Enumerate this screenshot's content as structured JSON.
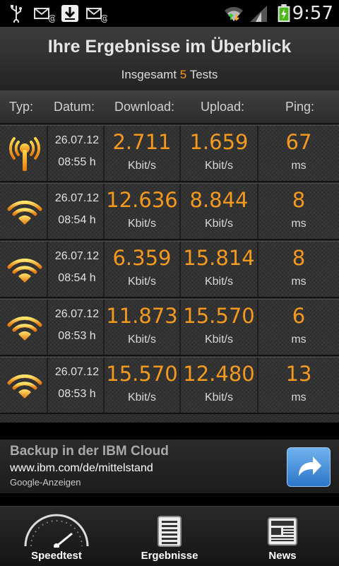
{
  "status_bar": {
    "time": "9:57",
    "icons": [
      "usb-icon",
      "voicemail-icon",
      "download-icon",
      "voicemail-icon",
      "wifi-icon",
      "signal-icon",
      "battery-charging-icon"
    ]
  },
  "header": {
    "title": "Ihre Ergebnisse im Überblick",
    "total_prefix": "Insgesamt",
    "total_count": "5",
    "total_suffix": "Tests"
  },
  "columns": {
    "type": "Typ:",
    "date": "Datum:",
    "download": "Download:",
    "upload": "Upload:",
    "ping": "Ping:"
  },
  "results": [
    {
      "type_icon": "cell-tower-icon",
      "date": "26.07.12",
      "time": "08:55 h",
      "download": "2.711",
      "download_unit": "Kbit/s",
      "upload": "1.659",
      "upload_unit": "Kbit/s",
      "ping": "67",
      "ping_unit": "ms"
    },
    {
      "type_icon": "wifi-icon",
      "date": "26.07.12",
      "time": "08:54 h",
      "download": "12.636",
      "download_unit": "Kbit/s",
      "upload": "8.844",
      "upload_unit": "Kbit/s",
      "ping": "8",
      "ping_unit": "ms"
    },
    {
      "type_icon": "wifi-icon",
      "date": "26.07.12",
      "time": "08:54 h",
      "download": "6.359",
      "download_unit": "Kbit/s",
      "upload": "15.814",
      "upload_unit": "Kbit/s",
      "ping": "8",
      "ping_unit": "ms"
    },
    {
      "type_icon": "wifi-icon",
      "date": "26.07.12",
      "time": "08:53 h",
      "download": "11.873",
      "download_unit": "Kbit/s",
      "upload": "15.570",
      "upload_unit": "Kbit/s",
      "ping": "6",
      "ping_unit": "ms"
    },
    {
      "type_icon": "wifi-icon",
      "date": "26.07.12",
      "time": "08:53 h",
      "download": "15.570",
      "download_unit": "Kbit/s",
      "upload": "12.480",
      "upload_unit": "Kbit/s",
      "ping": "13",
      "ping_unit": "ms"
    }
  ],
  "ad": {
    "title": "Backup in der IBM Cloud",
    "url": "www.ibm.com/de/mittelstand",
    "source": "Google-Anzeigen",
    "button_icon": "share-arrow-icon"
  },
  "nav": {
    "items": [
      {
        "label": "Speedtest",
        "icon": "speedometer-icon"
      },
      {
        "label": "Ergebnisse",
        "icon": "results-list-icon"
      },
      {
        "label": "News",
        "icon": "newspaper-icon"
      }
    ]
  },
  "colors": {
    "accent": "#f39a1e",
    "background": "#2e2e2e"
  }
}
